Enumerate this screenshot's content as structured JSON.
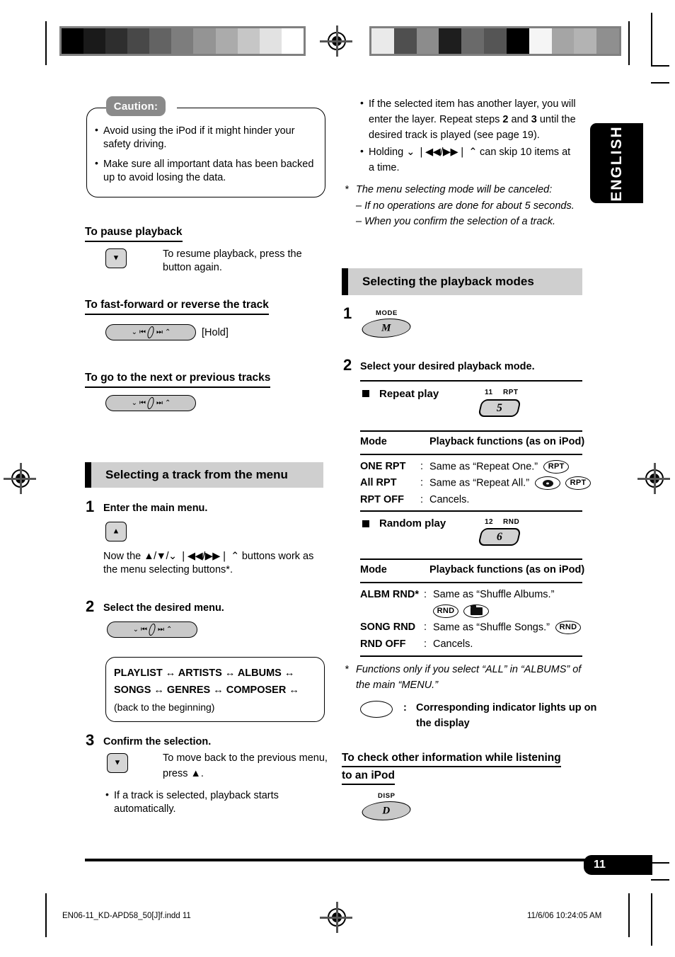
{
  "page": {
    "number": "11",
    "language_tab": "ENGLISH",
    "footer_left": "EN06-11_KD-APD58_50[J]f.indd   11",
    "footer_right": "11/6/06   10:24:05 AM",
    "colors": {
      "section_band": "#cfcfcf",
      "caution_tag": "#8a8a8a",
      "key_face": "#c9c9c9",
      "text": "#000000",
      "page_badge": "#000000"
    }
  },
  "left_column": {
    "caution": {
      "tag": "Caution:",
      "items": [
        "Avoid using the iPod if it might hinder your safety driving.",
        "Make sure all important data has been backed up to avoid losing the data."
      ]
    },
    "pause": {
      "heading": "To pause playback",
      "key_icon": "down-arrow-key",
      "text": "To resume playback, press the button again."
    },
    "ff_rev": {
      "heading": "To fast-forward or reverse the track",
      "key_icon": "track-seek-pill",
      "note": "[Hold]"
    },
    "next_prev": {
      "heading": "To go to the next or previous tracks",
      "key_icon": "track-seek-pill"
    },
    "section": {
      "title": "Selecting a track from the menu",
      "step1": {
        "no": "1",
        "label": "Enter the main menu.",
        "key_icon": "up-arrow-key",
        "body_pre": "Now the ",
        "body_glyphs": "▲/▼/⌄ ❘◀◀/▶▶❘ ⌃",
        "body_post": " buttons work as the menu selecting buttons*."
      },
      "step2": {
        "no": "2",
        "label": "Select the desired menu.",
        "key_icon": "track-seek-pill",
        "note_lines": [
          "PLAYLIST ↔ ARTISTS ↔ ALBUMS ↔",
          "SONGS ↔ GENRES ↔ COMPOSER ↔"
        ],
        "note_last": "(back to the beginning)"
      },
      "step3": {
        "no": "3",
        "label": "Confirm the selection.",
        "key_icon": "down-arrow-key",
        "text_l1": "To move back to the previous menu,",
        "text_l2": "press ▲.",
        "bullet": "If a track is selected, playback starts automatically."
      }
    }
  },
  "right_column": {
    "top_bullets": [
      {
        "l1": "If the selected item has another layer, you will",
        "l2_a": "enter the layer. Repeat steps ",
        "l2_b": "2",
        "l2_c": " and ",
        "l2_d": "3",
        "l2_e": " until the",
        "l3": "desired track is played (see page 19)."
      },
      {
        "l1_a": "Holding ",
        "l1_glyphs": "⌄ ❘◀◀/▶▶❘ ⌃",
        "l1_b": " can skip 10 items at",
        "l2": "a time."
      }
    ],
    "footnote": {
      "marker": "*",
      "head": "The menu selecting mode will be canceled:",
      "lines": [
        "– If no operations are done for about 5 seconds.",
        "– When you confirm the selection of a track."
      ]
    },
    "section": {
      "title": "Selecting the playback modes",
      "step1": {
        "no": "1",
        "key_caption": "MODE",
        "key_letter": "M"
      },
      "step2": {
        "no": "2",
        "label": "Select your desired playback mode."
      },
      "repeat": {
        "bullet_label": "Repeat play",
        "preset_caption_num": "11",
        "preset_caption_ind": "RPT",
        "preset_key": "5",
        "col_mode": "Mode",
        "col_func": "Playback functions (as on iPod)",
        "rows": [
          {
            "mode": "ONE RPT",
            "sep": ":",
            "func": "Same as “Repeat One.”",
            "badges": [
              "RPT"
            ]
          },
          {
            "mode": "All RPT",
            "sep": ":",
            "func": "Same as “Repeat All.”",
            "badges": [
              "disc",
              "RPT"
            ]
          },
          {
            "mode": "RPT OFF",
            "sep": ":",
            "func": "Cancels.",
            "badges": []
          }
        ]
      },
      "random": {
        "bullet_label": "Random play",
        "preset_caption_num": "12",
        "preset_caption_ind": "RND",
        "preset_key": "6",
        "col_mode": "Mode",
        "col_func": "Playback functions (as on iPod)",
        "rows": [
          {
            "mode": "ALBM RND",
            "star": "*",
            "sep": ":",
            "func": "Same as “Shuffle Albums.”",
            "badges": [
              "RND",
              "folder"
            ]
          },
          {
            "mode": "SONG RND",
            "star": "",
            "sep": ":",
            "func": "Same as “Shuffle Songs.”",
            "badges": [
              "RND"
            ]
          },
          {
            "mode": "RND OFF",
            "star": "",
            "sep": ":",
            "func": "Cancels.",
            "badges": []
          }
        ]
      },
      "star_note": {
        "marker": "*",
        "l1": "Functions only if you select “ALL” in “ALBUMS” of",
        "l2": "the main “MENU.”"
      },
      "legend": {
        "sep": ":",
        "l1": "Corresponding indicator lights up on",
        "l2": "the display"
      }
    },
    "disp": {
      "heading_l1": "To check other information while listening",
      "heading_l2": "to an iPod",
      "key_caption": "DISP",
      "key_letter": "D"
    }
  },
  "reg_bars": {
    "left": [
      "#000000",
      "#1a1a1a",
      "#2e2e2e",
      "#484848",
      "#636363",
      "#7d7d7d",
      "#949494",
      "#ababab",
      "#c6c6c6",
      "#e2e2e2",
      "#ffffff"
    ],
    "right": [
      "#eaeaea",
      "#4f4f4f",
      "#8c8c8c",
      "#1e1e1e",
      "#6a6a6a",
      "#555555",
      "#000000",
      "#f5f5f5",
      "#a5a5a5",
      "#b3b3b3",
      "#8f8f8f"
    ]
  }
}
